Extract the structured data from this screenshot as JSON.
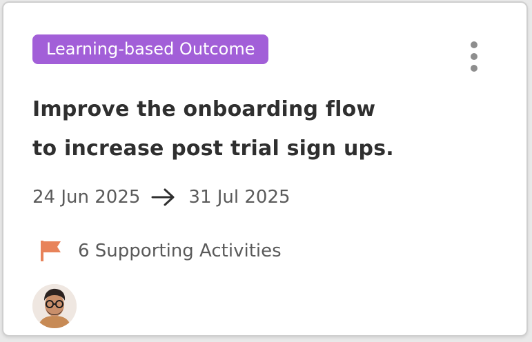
{
  "card": {
    "badge_label": "Learning-based Outcome",
    "title_line1": "Improve the onboarding flow",
    "title_line2": "to increase post trial sign ups.",
    "start_date": "24 Jun 2025",
    "end_date": "31 Jul 2025",
    "activities_label": "6 Supporting Activities",
    "icons": {
      "more": "more-vertical-icon",
      "arrow": "arrow-right-icon",
      "flag": "flag-icon"
    },
    "colors": {
      "badge_bg": "#a25fd8",
      "flag": "#e8835a"
    }
  }
}
